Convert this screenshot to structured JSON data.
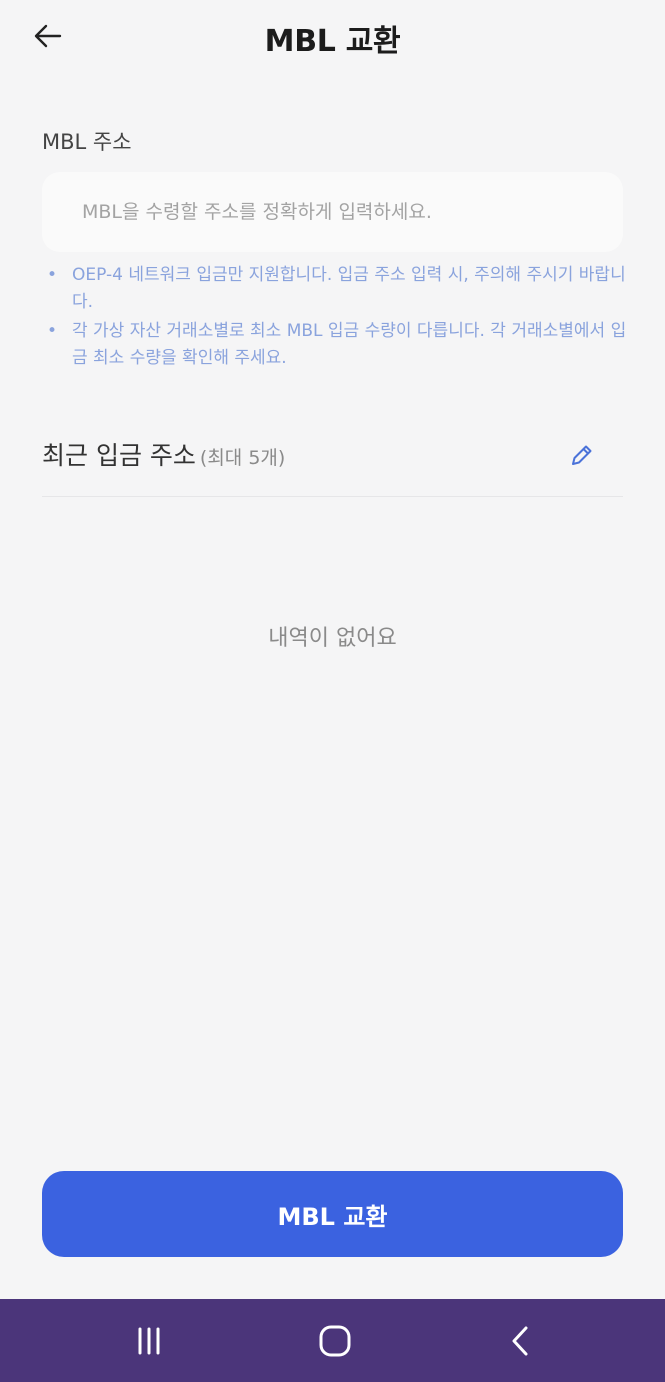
{
  "header": {
    "title": "MBL 교환",
    "back_icon": "arrow-left-icon"
  },
  "address": {
    "label": "MBL 주소",
    "value": "",
    "placeholder": "MBL을 수령할 주소를 정확하게 입력하세요."
  },
  "notes": [
    "OEP-4 네트워크 입금만 지원합니다. 입금 주소 입력 시, 주의해 주시기 바랍니다.",
    "각 가상 자산 거래소별로 최소 MBL 입금 수량이 다릅니다. 각 거래소별에서 입금 최소 수량을 확인해 주세요."
  ],
  "recent": {
    "title": "최근 입금 주소",
    "subtitle": "(최대 5개)",
    "edit_icon": "pencil-icon",
    "empty_text": "내역이 없어요"
  },
  "submit": {
    "label": "MBL 교환"
  },
  "colors": {
    "background": "#f5f5f6",
    "accent": "#3b62e0",
    "note_text": "#8aa3dd",
    "navbar": "#4b357a"
  },
  "system_nav": {
    "recents_icon": "recents-icon",
    "home_icon": "home-icon",
    "back_icon": "chevron-left-icon"
  }
}
